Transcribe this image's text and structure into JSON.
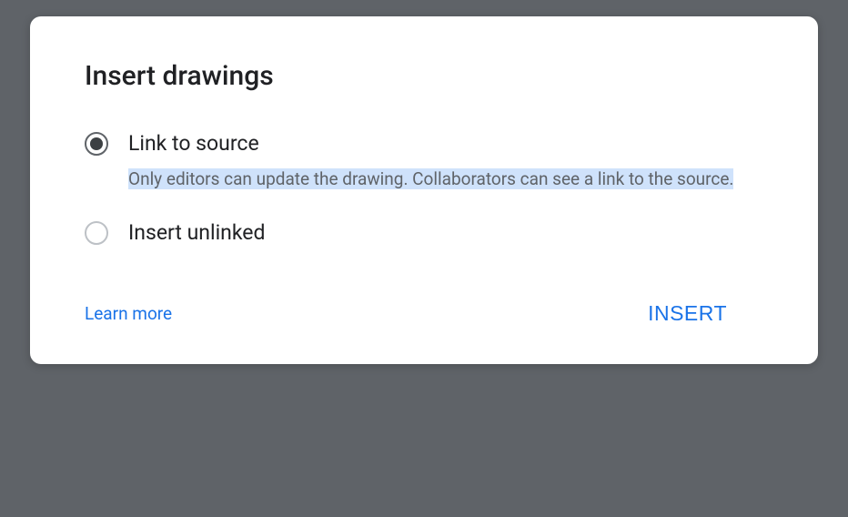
{
  "dialog": {
    "title": "Insert drawings",
    "options": [
      {
        "label": "Link to source",
        "description": "Only editors can update the drawing. Collaborators can see a link to the source.",
        "selected": true,
        "highlighted": true
      },
      {
        "label": "Insert unlinked",
        "description": "",
        "selected": false,
        "highlighted": false
      }
    ],
    "learn_more_label": "Learn more",
    "insert_button_label": "INSERT"
  }
}
